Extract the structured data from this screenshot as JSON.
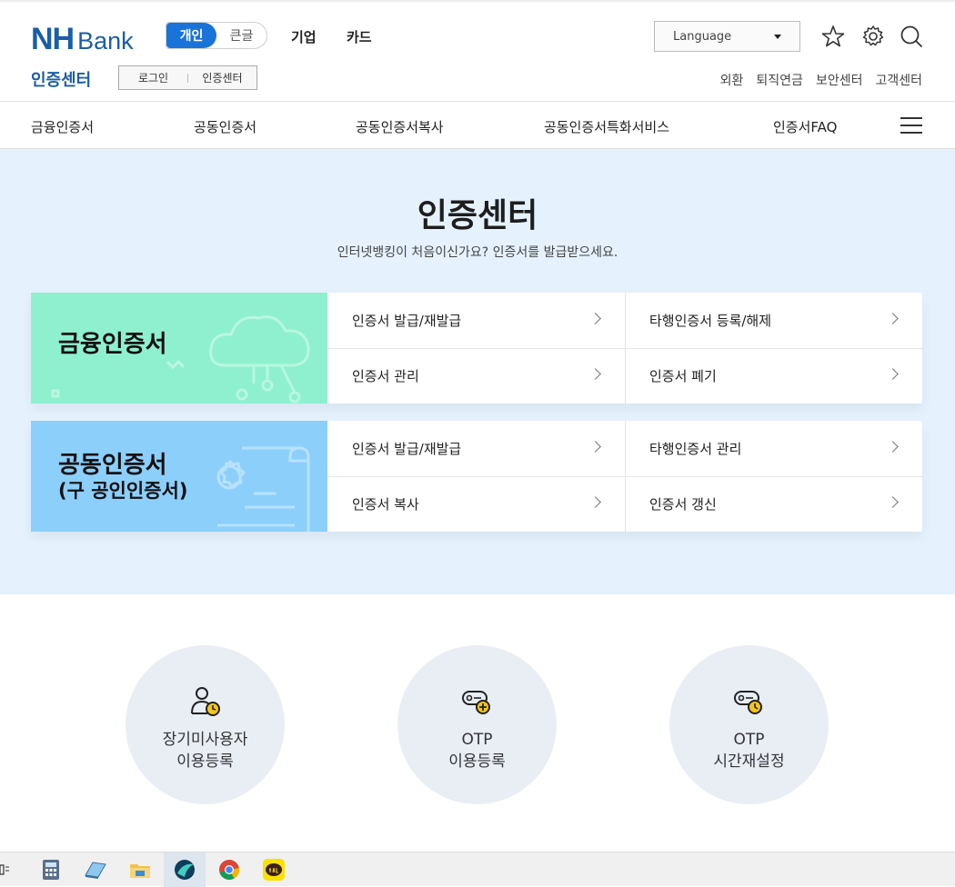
{
  "header": {
    "logo_nh": "NH",
    "logo_bank": "Bank",
    "segment_personal": "개인",
    "segment_largefont": "큰글",
    "link_business": "기업",
    "link_card": "카드",
    "language_label": "Language",
    "section_title": "인증센터",
    "login_label": "로그인",
    "cert_label": "인증센터",
    "right_links": [
      "외환",
      "퇴직연금",
      "보안센터",
      "고객센터"
    ]
  },
  "gnb": [
    "금융인증서",
    "공동인증서",
    "공동인증서복사",
    "공동인증서특화서비스",
    "인증서FAQ"
  ],
  "hero": {
    "title": "인증센터",
    "subtitle": "인터넷뱅킹이 처음이신가요? 인증서를 발급받으세요."
  },
  "cards": [
    {
      "title": "금융인증서",
      "subtitle": "",
      "color": "#8ef0cf",
      "items": [
        "인증서 발급/재발급",
        "타행인증서 등록/해제",
        "인증서 관리",
        "인증서 폐기"
      ]
    },
    {
      "title": "공동인증서",
      "subtitle": "(구 공인인증서)",
      "color": "#8ccffb",
      "items": [
        "인증서 발급/재발급",
        "타행인증서 관리",
        "인증서 복사",
        "인증서 갱신"
      ]
    }
  ],
  "quick": [
    {
      "line1": "장기미사용자",
      "line2": "이용등록",
      "icon": "user-clock-icon"
    },
    {
      "line1": "OTP",
      "line2": "이용등록",
      "icon": "otp-plus-icon"
    },
    {
      "line1": "OTP",
      "line2": "시간재설정",
      "icon": "otp-clock-icon"
    }
  ],
  "colors": {
    "brand": "#1a5ea8",
    "accent": "#1a73d8",
    "hero_bg": "#e5f2fd",
    "icon_yellow": "#f5c518"
  }
}
